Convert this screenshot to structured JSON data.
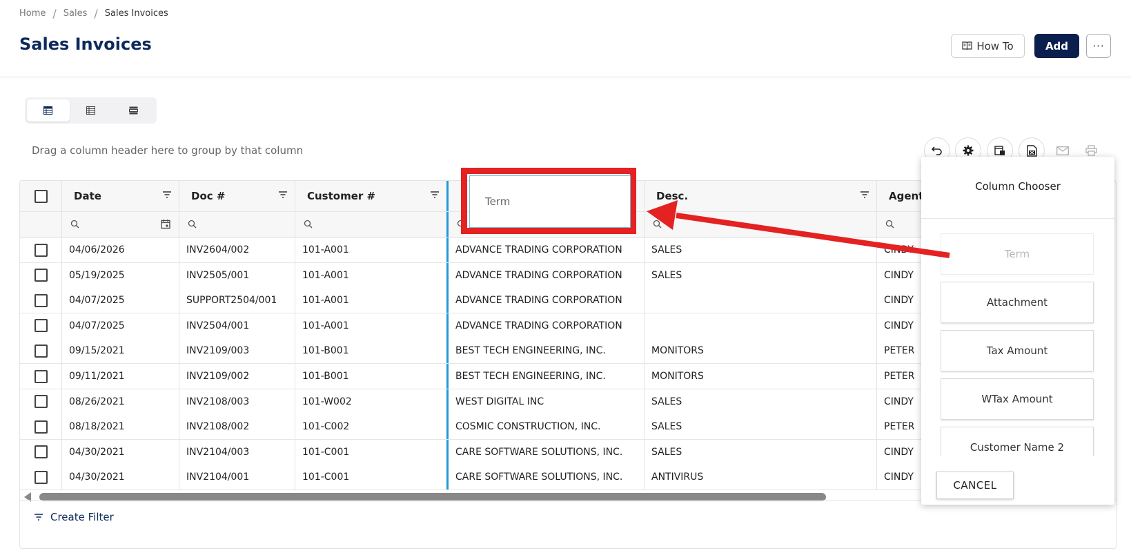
{
  "breadcrumb": {
    "items": [
      "Home",
      "Sales",
      "Sales Invoices"
    ],
    "separator": "/"
  },
  "page_title": "Sales Invoices",
  "header_buttons": {
    "how_to": "How To",
    "add": "Add",
    "more": "···"
  },
  "group_hint": "Drag a column header here to group by that column",
  "grid": {
    "columns": [
      "",
      "Date",
      "Doc #",
      "Customer #",
      "",
      "Desc.",
      "Agent"
    ],
    "rows": [
      {
        "date": "04/06/2026",
        "doc": "INV2604/002",
        "cust": "101-A001",
        "name": "ADVANCE TRADING CORPORATION",
        "desc": "SALES",
        "agent": "CINDY"
      },
      {
        "date": "05/19/2025",
        "doc": "INV2505/001",
        "cust": "101-A001",
        "name": "ADVANCE TRADING CORPORATION",
        "desc": "SALES",
        "agent": "CINDY"
      },
      {
        "date": "04/07/2025",
        "doc": "SUPPORT2504/001",
        "cust": "101-A001",
        "name": "ADVANCE TRADING CORPORATION",
        "desc": "",
        "agent": "CINDY"
      },
      {
        "date": "04/07/2025",
        "doc": "INV2504/001",
        "cust": "101-A001",
        "name": "ADVANCE TRADING CORPORATION",
        "desc": "",
        "agent": "CINDY"
      },
      {
        "date": "09/15/2021",
        "doc": "INV2109/003",
        "cust": "101-B001",
        "name": "BEST TECH ENGINEERING, INC.",
        "desc": "MONITORS",
        "agent": "PETER"
      },
      {
        "date": "09/11/2021",
        "doc": "INV2109/002",
        "cust": "101-B001",
        "name": "BEST TECH ENGINEERING, INC.",
        "desc": "MONITORS",
        "agent": "PETER"
      },
      {
        "date": "08/26/2021",
        "doc": "INV2108/003",
        "cust": "101-W002",
        "name": "WEST DIGITAL INC",
        "desc": "SALES",
        "agent": "CINDY"
      },
      {
        "date": "08/18/2021",
        "doc": "INV2108/002",
        "cust": "101-C002",
        "name": "COSMIC CONSTRUCTION, INC.",
        "desc": "SALES",
        "agent": "PETER"
      },
      {
        "date": "04/30/2021",
        "doc": "INV2104/003",
        "cust": "101-C001",
        "name": "CARE SOFTWARE SOLUTIONS, INC.",
        "desc": "SALES",
        "agent": "CINDY"
      },
      {
        "date": "04/30/2021",
        "doc": "INV2104/001",
        "cust": "101-C001",
        "name": "CARE SOFTWARE SOLUTIONS, INC.",
        "desc": "ANTIVIRUS",
        "agent": "CINDY"
      }
    ],
    "create_filter": "Create Filter"
  },
  "drag_ghost": {
    "label": "Term"
  },
  "column_chooser": {
    "title": "Column Chooser",
    "items": [
      "Term",
      "Attachment",
      "Tax Amount",
      "WTax Amount",
      "Customer Name 2"
    ],
    "cancel": "CANCEL"
  },
  "colors": {
    "brand": "#0b1f4f",
    "link": "#29a8e0",
    "annotation": "#e42222",
    "drop_indicator": "#1f9ad6"
  }
}
